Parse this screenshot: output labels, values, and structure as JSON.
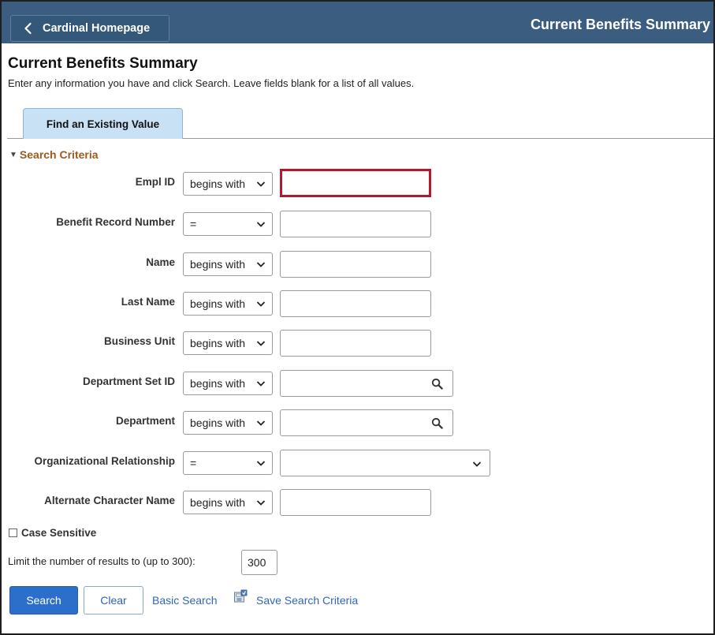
{
  "header": {
    "home_button_label": "Cardinal Homepage",
    "banner_title": "Current Benefits Summary"
  },
  "page": {
    "title": "Current Benefits Summary",
    "instructions": "Enter any information you have and click Search. Leave fields blank for a list of all values."
  },
  "tabs": [
    {
      "label": "Find an Existing Value"
    }
  ],
  "section": {
    "title": "Search Criteria"
  },
  "fields": [
    {
      "label": "Empl ID",
      "operator": "begins with",
      "value": ""
    },
    {
      "label": "Benefit Record Number",
      "operator": "=",
      "value": ""
    },
    {
      "label": "Name",
      "operator": "begins with",
      "value": ""
    },
    {
      "label": "Last Name",
      "operator": "begins with",
      "value": ""
    },
    {
      "label": "Business Unit",
      "operator": "begins with",
      "value": ""
    },
    {
      "label": "Department Set ID",
      "operator": "begins with",
      "value": ""
    },
    {
      "label": "Department",
      "operator": "begins with",
      "value": ""
    },
    {
      "label": "Organizational Relationship",
      "operator": "=",
      "value": ""
    },
    {
      "label": "Alternate Character Name",
      "operator": "begins with",
      "value": ""
    }
  ],
  "options": {
    "case_sensitive_label": "Case Sensitive",
    "limit_label": "Limit the number of results to (up to 300):",
    "limit_value": "300"
  },
  "actions": {
    "search_label": "Search",
    "clear_label": "Clear",
    "basic_search_label": "Basic Search",
    "save_search_label": "Save Search Criteria"
  },
  "colors": {
    "banner": "#3b5e80",
    "section_title": "#9c5a1f",
    "focus_outline": "#b3182f",
    "primary_button": "#2b6fcb",
    "link": "#2f67b5"
  }
}
